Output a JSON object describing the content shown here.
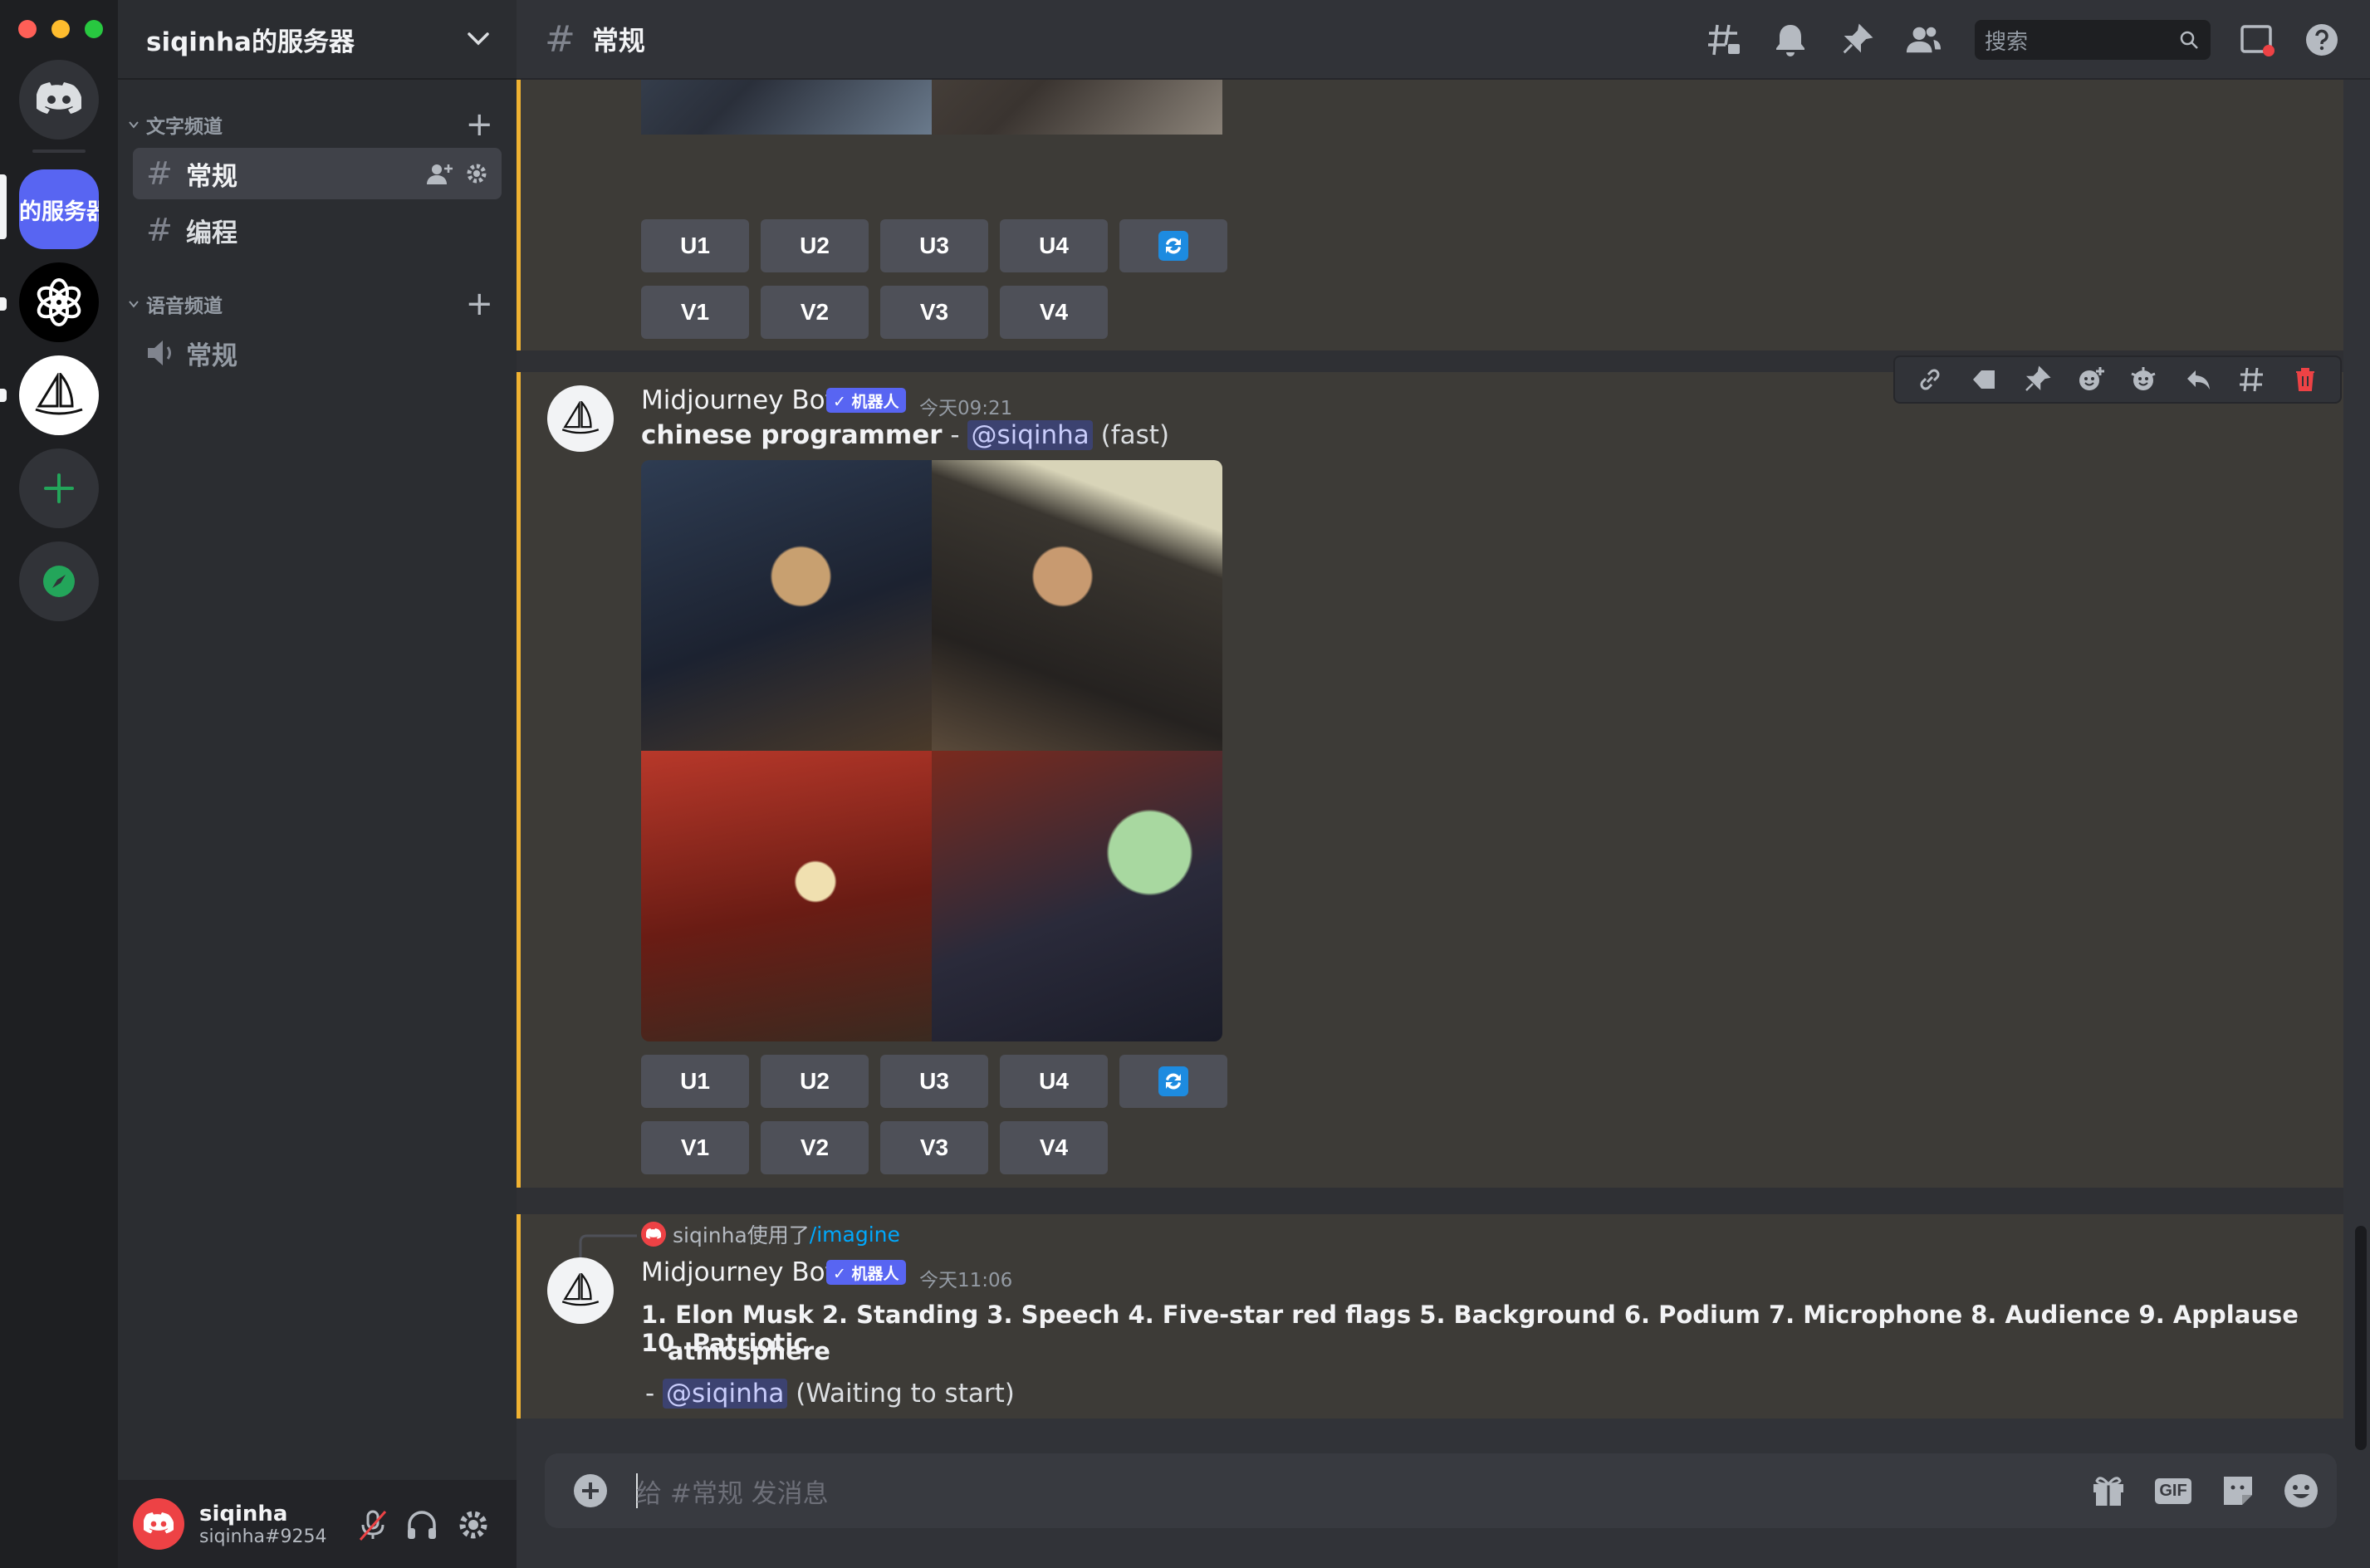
{
  "server": {
    "name": "siqinha的服务器",
    "active_server_label": "的服务器"
  },
  "categories": {
    "text": "文字频道",
    "voice": "语音频道"
  },
  "channels": {
    "text": [
      {
        "name": "常规",
        "active": true
      },
      {
        "name": "编程",
        "active": false
      }
    ],
    "voice": [
      {
        "name": "常规"
      }
    ]
  },
  "user": {
    "display_name": "siqinha",
    "tag": "siqinha#9254"
  },
  "topbar": {
    "channel_name": "常规",
    "search_placeholder": "搜索"
  },
  "messages": [
    {
      "author": "",
      "buttons_row1": [
        "U1",
        "U2",
        "U3",
        "U4"
      ],
      "buttons_row2": [
        "V1",
        "V2",
        "V3",
        "V4"
      ]
    },
    {
      "author": "Midjourney Bot",
      "badge": "✓ 机器人",
      "timestamp": "今天09:21",
      "prompt": "chinese programmer",
      "separator": " - ",
      "mention": "@siqinha",
      "suffix": " (fast)",
      "buttons_row1": [
        "U1",
        "U2",
        "U3",
        "U4"
      ],
      "buttons_row2": [
        "V1",
        "V2",
        "V3",
        "V4"
      ]
    },
    {
      "reply_user": "siqinha使用了",
      "reply_command": "/imagine",
      "author": "Midjourney Bot",
      "badge": "✓ 机器人",
      "timestamp": "今天11:06",
      "prompt_line1": "1. Elon Musk 2. Standing 3. Speech 4. Five-star red flags 5. Background 6. Podium 7. Microphone 8. Audience 9. Applause 10. Patriotic",
      "prompt_line2": "atmosphere",
      "dash": "- ",
      "mention": "@siqinha",
      "suffix": " (Waiting to start)"
    }
  ],
  "composer": {
    "placeholder": "给 #常规 发消息",
    "gif_label": "GIF"
  },
  "colors": {
    "accent": "#5865f2",
    "highlight_border": "#f0b232",
    "highlight_bg": "#3d3b37",
    "danger": "#ed4245",
    "green": "#23a55a"
  }
}
